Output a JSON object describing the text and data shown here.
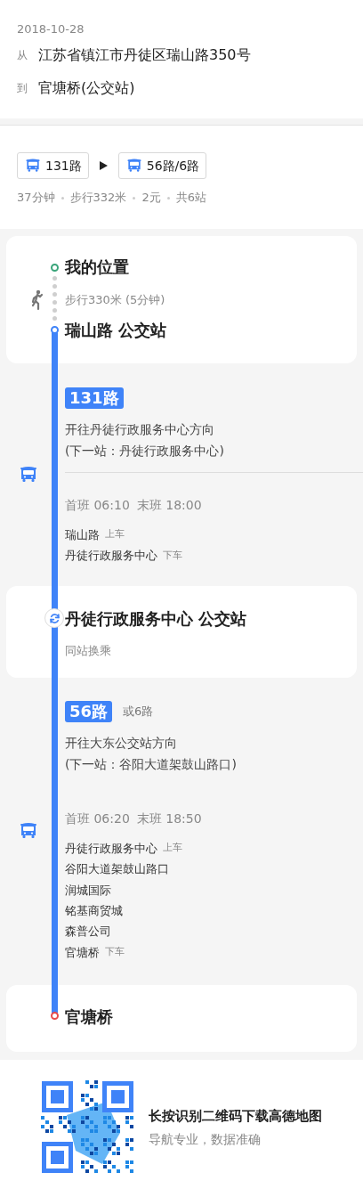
{
  "header": {
    "date": "2018-10-28",
    "from": {
      "label": "从",
      "value": "江苏省镇江市丹徒区瑞山路350号"
    },
    "to": {
      "label": "到",
      "value": "官塘桥(公交站)"
    }
  },
  "summary": {
    "lines": [
      {
        "name": "131路"
      },
      {
        "name": "56路/6路"
      }
    ],
    "meta": [
      "37分钟",
      "步行332米",
      "2元",
      "共6站"
    ]
  },
  "steps": [
    {
      "kind": "start",
      "title": "我的位置",
      "walk": "步行330米 (5分钟)",
      "end": "瑞山路 公交站"
    },
    {
      "kind": "bus",
      "line": "131路",
      "direction": "开往丹徒行政服务中心方向",
      "next": "(下一站：丹徒行政服务中心)",
      "divider": true,
      "times": [
        "首班 06:10",
        "末班 18:00"
      ],
      "stops": [
        {
          "name": "瑞山路",
          "action": "上车"
        },
        {
          "name": "丹徒行政服务中心",
          "action": "下车"
        }
      ]
    },
    {
      "kind": "transfer",
      "title": "丹徒行政服务中心 公交站",
      "subtitle": "同站换乘"
    },
    {
      "kind": "bus",
      "line": "56路",
      "alt": "或6路",
      "direction": "开往大东公交站方向",
      "next": "(下一站：谷阳大道架鼓山路口)",
      "divider": false,
      "times": [
        "首班 06:20",
        "末班 18:50"
      ],
      "stops": [
        {
          "name": "丹徒行政服务中心",
          "action": "上车"
        },
        {
          "name": "谷阳大道架鼓山路口"
        },
        {
          "name": "润城国际"
        },
        {
          "name": "铭基商贸城"
        },
        {
          "name": "森普公司"
        },
        {
          "name": "官塘桥",
          "action": "下车"
        }
      ]
    },
    {
      "kind": "end",
      "title": "官塘桥"
    }
  ],
  "footer": {
    "title": "长按识别二维码下载高德地图",
    "subtitle": "导航专业，数据准确"
  }
}
